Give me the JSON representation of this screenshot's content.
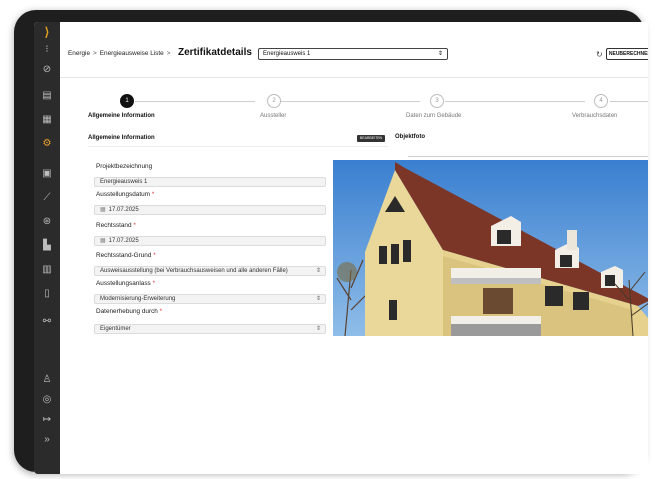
{
  "breadcrumb": {
    "items": [
      "Energie",
      "Energieausweise Liste"
    ],
    "separator": ">"
  },
  "page": {
    "title": "Zertifikatdetails",
    "certificate_select": "Energieausweis 1",
    "recalc_label": "NEUBERECHNEN"
  },
  "steps": [
    {
      "number": "1",
      "label": "Allgemeine Information",
      "active": true
    },
    {
      "number": "2",
      "label": "Aussteller",
      "active": false
    },
    {
      "number": "3",
      "label": "Daten zum Gebäude",
      "active": false
    },
    {
      "number": "4",
      "label": "Verbrauchsdaten",
      "active": false
    }
  ],
  "section": {
    "title": "Allgemeine Information",
    "edit_label": "BEARBEITEN",
    "photo_title": "Objektfoto"
  },
  "form": {
    "projektbezeichnung": {
      "label": "Projektbezeichnung",
      "value": "Energieausweis 1"
    },
    "ausstellungsdatum": {
      "label": "Ausstellungsdatum",
      "value": "17.07.2025"
    },
    "rechtsstand": {
      "label": "Rechtsstand",
      "value": "17.07.2025"
    },
    "rechtsstand_grund": {
      "label": "Rechtsstand-Grund",
      "value": "Ausweisausstellung (bei Verbrauchsausweisen und alle anderen Fälle)"
    },
    "ausstellungsanlass": {
      "label": "Ausstellungsanlass",
      "value": "Modernisierung-Erweiterung"
    },
    "datenerhebung": {
      "label": "Datenerhebung durch",
      "value": "Eigentümer"
    },
    "required_mark": "*"
  },
  "colors": {
    "sidebar": "#2b2b2b",
    "accent": "#e8a030",
    "sky": "#4a90d8",
    "wall": "#e8d9a0",
    "roof": "#7a3a2a"
  },
  "icons": {
    "sidebar": [
      "logo-icon",
      "chart-icon",
      "help-icon",
      "document-icon",
      "grid-icon",
      "certificate-icon",
      "list-icon",
      "line-chart-icon",
      "star-icon",
      "bar-chart-icon",
      "column-chart-icon",
      "calculator-icon",
      "settings-icon",
      "user-icon",
      "headset-icon",
      "logout-icon",
      "expand-icon"
    ]
  }
}
